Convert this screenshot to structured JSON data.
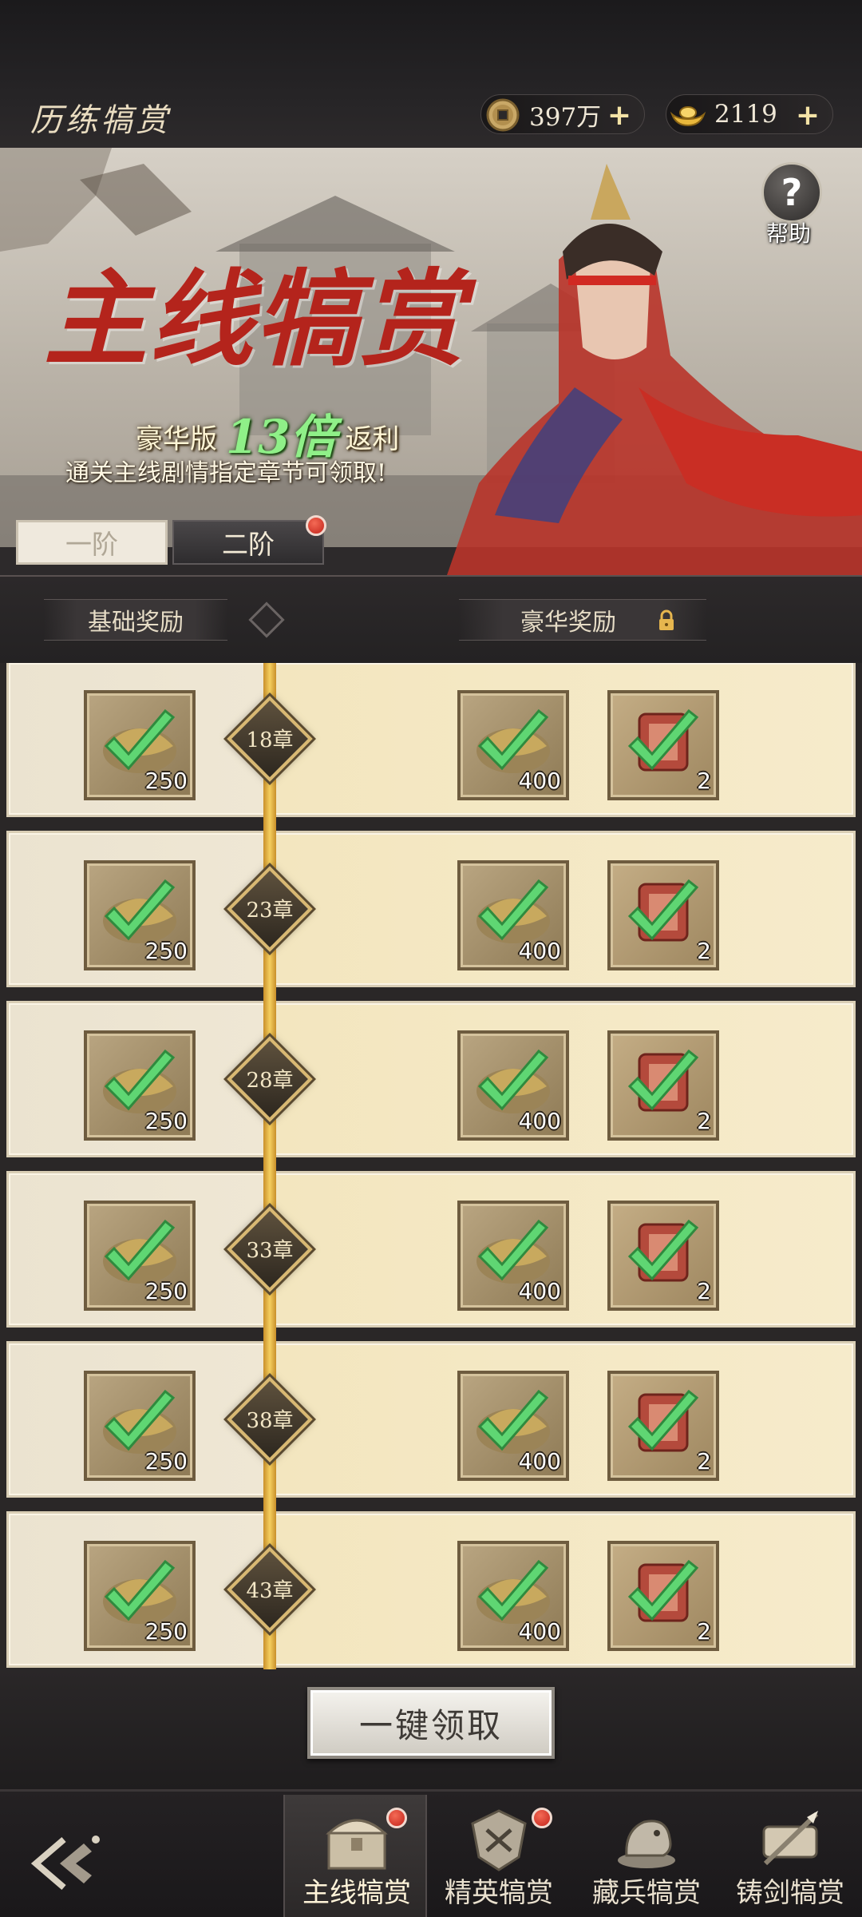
{
  "header": {
    "title": "历练犒赏",
    "coins": {
      "icon": "copper-coin-icon",
      "value": "397万"
    },
    "ingots": {
      "icon": "gold-ingot-icon",
      "value": "2119"
    }
  },
  "banner": {
    "title": "主线犒赏",
    "subtitle_prefix": "豪华版",
    "multiplier": "13倍",
    "subtitle_suffix": "返利",
    "note": "通关主线剧情指定章节可领取!",
    "help_label": "帮助",
    "tiers": [
      "一阶",
      "二阶"
    ],
    "active_tier": "一阶"
  },
  "sections": {
    "basic": "基础奖励",
    "deluxe": "豪华奖励"
  },
  "rows": [
    {
      "chapter": "18章",
      "basic_qty": "250",
      "deluxe_qty_1": "400",
      "deluxe_qty_2": "2",
      "claimed": true
    },
    {
      "chapter": "23章",
      "basic_qty": "250",
      "deluxe_qty_1": "400",
      "deluxe_qty_2": "2",
      "claimed": true
    },
    {
      "chapter": "28章",
      "basic_qty": "250",
      "deluxe_qty_1": "400",
      "deluxe_qty_2": "2",
      "claimed": true
    },
    {
      "chapter": "33章",
      "basic_qty": "250",
      "deluxe_qty_1": "400",
      "deluxe_qty_2": "2",
      "claimed": true
    },
    {
      "chapter": "38章",
      "basic_qty": "250",
      "deluxe_qty_1": "400",
      "deluxe_qty_2": "2",
      "claimed": true
    },
    {
      "chapter": "43章",
      "basic_qty": "250",
      "deluxe_qty_1": "400",
      "deluxe_qty_2": "2",
      "claimed": true
    }
  ],
  "claim_all": "一键领取",
  "nav": {
    "tabs": [
      "主线犒赏",
      "精英犒赏",
      "藏兵犒赏",
      "铸剑犒赏"
    ],
    "active": "主线犒赏"
  },
  "colors": {
    "accent_gold": "#f5cf5f",
    "check_green": "#4fcf62",
    "badge_red": "#c3231a",
    "title_red": "#b4241c",
    "multiplier_green": "#8ff088"
  }
}
